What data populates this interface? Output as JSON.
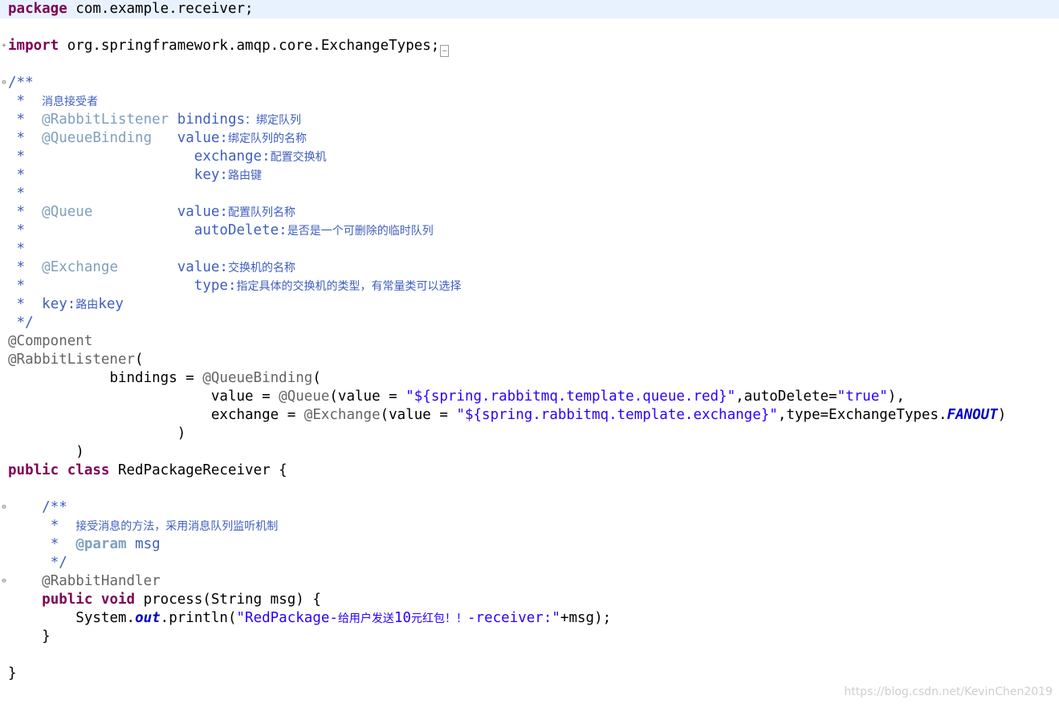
{
  "editor": {
    "package_kw": "package",
    "package_name": " com.example.receiver;",
    "import_kw": "import",
    "import_name": " org.springframework.amqp.core.ExchangeTypes;",
    "import_fold": "…",
    "fold_expand": "+",
    "fold_collapse": "⊖",
    "doc": {
      "open": "/**",
      "star": " * ",
      "close": " */",
      "summary": "消息接受者",
      "rabbit_listener_tag": "@RabbitListener",
      "rabbit_listener_param": "bindings",
      "rabbit_listener_desc": "：绑定队列",
      "queue_binding_tag": "@QueueBinding",
      "qb_value": "value:",
      "qb_value_desc": "绑定队列的名称",
      "qb_exchange": "exchange:",
      "qb_exchange_desc": "配置交换机",
      "qb_key": "key:",
      "qb_key_desc": "路由键",
      "queue_tag": "@Queue",
      "q_value": "value:",
      "q_value_desc": "配置队列名称",
      "q_autodelete": "autoDelete:",
      "q_autodelete_desc": "是否是一个可删除的临时队列",
      "exchange_tag": "@Exchange",
      "ex_value": "value:",
      "ex_value_desc": "交换机的名称",
      "ex_type": "type:",
      "ex_type_desc": "指定具体的交换机的类型，有常量类可以选择",
      "key_label": "key:",
      "key_desc_cjk": "路由",
      "key_desc_tail": "key"
    },
    "ann_component": "@Component",
    "ann_rabbit_listener": "@RabbitListener",
    "paren_open": "(",
    "bindings_prefix": "bindings = ",
    "ann_queue_binding": "@QueueBinding",
    "value_prefix": "value = ",
    "ann_queue": "@Queue",
    "queue_value_arg": "(value = ",
    "queue_value_str": "\"${spring.rabbitmq.template.queue.red}\"",
    "queue_autodelete_arg": ",autoDelete=",
    "queue_autodelete_str": "\"true\"",
    "queue_close": "),",
    "exchange_prefix": "exchange = ",
    "ann_exchange": "@Exchange",
    "exchange_value_arg": "(value = ",
    "exchange_value_str": "\"${spring.rabbitmq.template.exchange}\"",
    "exchange_type_arg": ",type=ExchangeTypes.",
    "exchange_type_field": "FANOUT",
    "exchange_close": ")",
    "inner_close": ")",
    "outer_close": ")",
    "public_kw": "public",
    "class_kw": "class",
    "class_name": " RedPackageReceiver {",
    "method_doc": {
      "open": "/**",
      "star": " *  ",
      "close": " */",
      "summary": "接受消息的方法，采用消息队列监听机制",
      "param_tag": "@param",
      "param_name": " msg"
    },
    "ann_rabbit_handler": "@RabbitHandler",
    "void_kw": "void",
    "method_sig": " process(String msg) {",
    "sysout_prefix": "System.",
    "sysout_field": "out",
    "sysout_call": ".println(",
    "str_part1": "\"RedPackage-",
    "str_cjk1": "给用户发送",
    "str_num": "10",
    "str_cjk2": "元红包！！",
    "str_part2": "-receiver:\"",
    "sysout_tail": "+msg);",
    "method_close": "}",
    "class_close": "}"
  },
  "watermark": "https://blog.csdn.net/KevinChen2019"
}
